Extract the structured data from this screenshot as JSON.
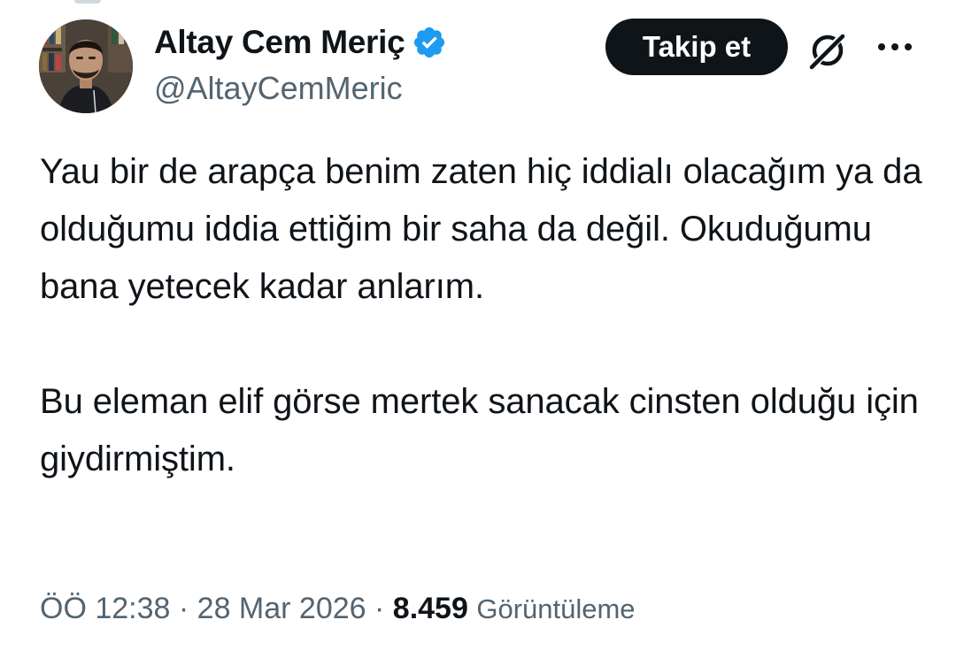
{
  "author": {
    "display_name": "Altay Cem Meriç",
    "handle": "@AltayCemMeric",
    "verified": true,
    "verified_color": "#1d9bf0"
  },
  "actions": {
    "follow_label": "Takip et",
    "grok_icon": "grok-slash-icon",
    "more_icon": "more-dots-icon"
  },
  "tweet": {
    "paragraphs": [
      "Yau bir de arapça benim zaten hiç iddialı olacağım ya da olduğumu iddia ettiğim bir saha da değil. Okuduğumu bana yetecek kadar anlarım.",
      "Bu eleman elif görse mertek sanacak cinsten olduğu için giydirmiştim."
    ]
  },
  "meta": {
    "time": "ÖÖ 12:38",
    "separator": "·",
    "date": "28 Mar 2026",
    "views_count": "8.459",
    "views_label": "Görüntüleme"
  },
  "colors": {
    "text_primary": "#0f1419",
    "text_secondary": "#536471",
    "button_bg": "#0f1419"
  }
}
